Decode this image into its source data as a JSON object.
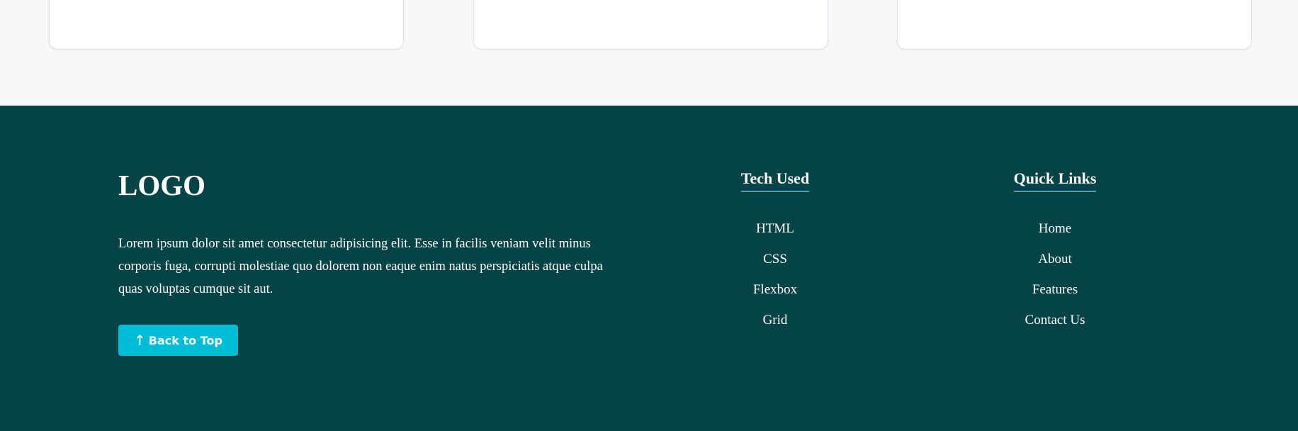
{
  "footer": {
    "logo": "LOGO",
    "description": "Lorem ipsum dolor sit amet consectetur adipisicing elit. Esse in facilis veniam velit minus corporis fuga, corrupti molestiae quo dolorem non eaque enim natus perspiciatis atque culpa quas voluptas cumque sit aut.",
    "back_to_top": {
      "icon": "↑",
      "label": "Back to Top"
    },
    "tech_used": {
      "title": "Tech Used",
      "items": [
        "HTML",
        "CSS",
        "Flexbox",
        "Grid"
      ]
    },
    "quick_links": {
      "title": "Quick Links",
      "items": [
        "Home",
        "About",
        "Features",
        "Contact Us"
      ]
    }
  },
  "colors": {
    "footer_bg": "#044346",
    "accent": "#00bcd4",
    "page_bg": "#f6f8fa",
    "card_bg": "#ffffff"
  }
}
